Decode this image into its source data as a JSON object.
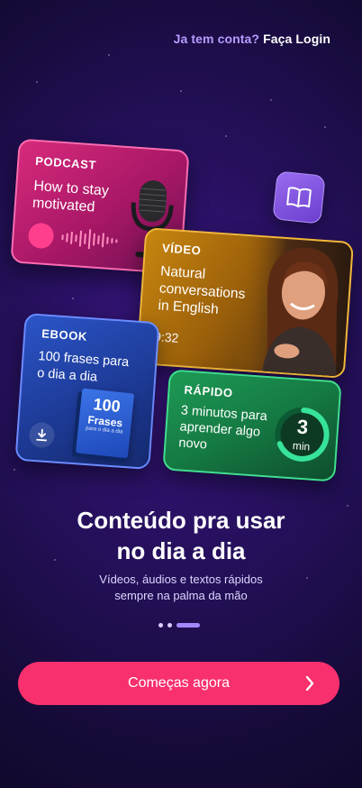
{
  "header": {
    "login_question": "Ja tem conta?",
    "login_link": "Faça Login"
  },
  "cards": {
    "podcast": {
      "kicker": "PODCAST",
      "title": "How to stay motivated"
    },
    "video": {
      "kicker": "VÍDEO",
      "title": "Natural conversations in English",
      "duration": "9:32"
    },
    "ebook": {
      "kicker": "EBOOK",
      "title": "100 frases para o dia a dia",
      "cover_number": "100",
      "cover_title": "Frases",
      "cover_subtitle": "para o dia a dia"
    },
    "rapido": {
      "kicker": "RÁPIDO",
      "title": "3 minutos para aprender algo novo",
      "timer_value": "3",
      "timer_unit": "min"
    }
  },
  "hero": {
    "headline_line1": "Conteúdo pra usar",
    "headline_line2": "no dia a dia",
    "subtitle_line1": "Vídeos, áudios e textos rápidos",
    "subtitle_line2": "sempre na palma da mão"
  },
  "pagination": {
    "total": 3,
    "active_index": 2
  },
  "cta": {
    "label": "Começas agora"
  },
  "icons": {
    "podcast": "microphone-icon",
    "badge": "open-book-icon",
    "download": "download-icon",
    "cta": "chevron-right-icon"
  },
  "colors": {
    "accent": "#f9306e",
    "login_question": "#b79cff",
    "podcast": "#d82a7c",
    "video": "#c8860f",
    "ebook": "#2b55c8",
    "rapido": "#1e9a55"
  }
}
